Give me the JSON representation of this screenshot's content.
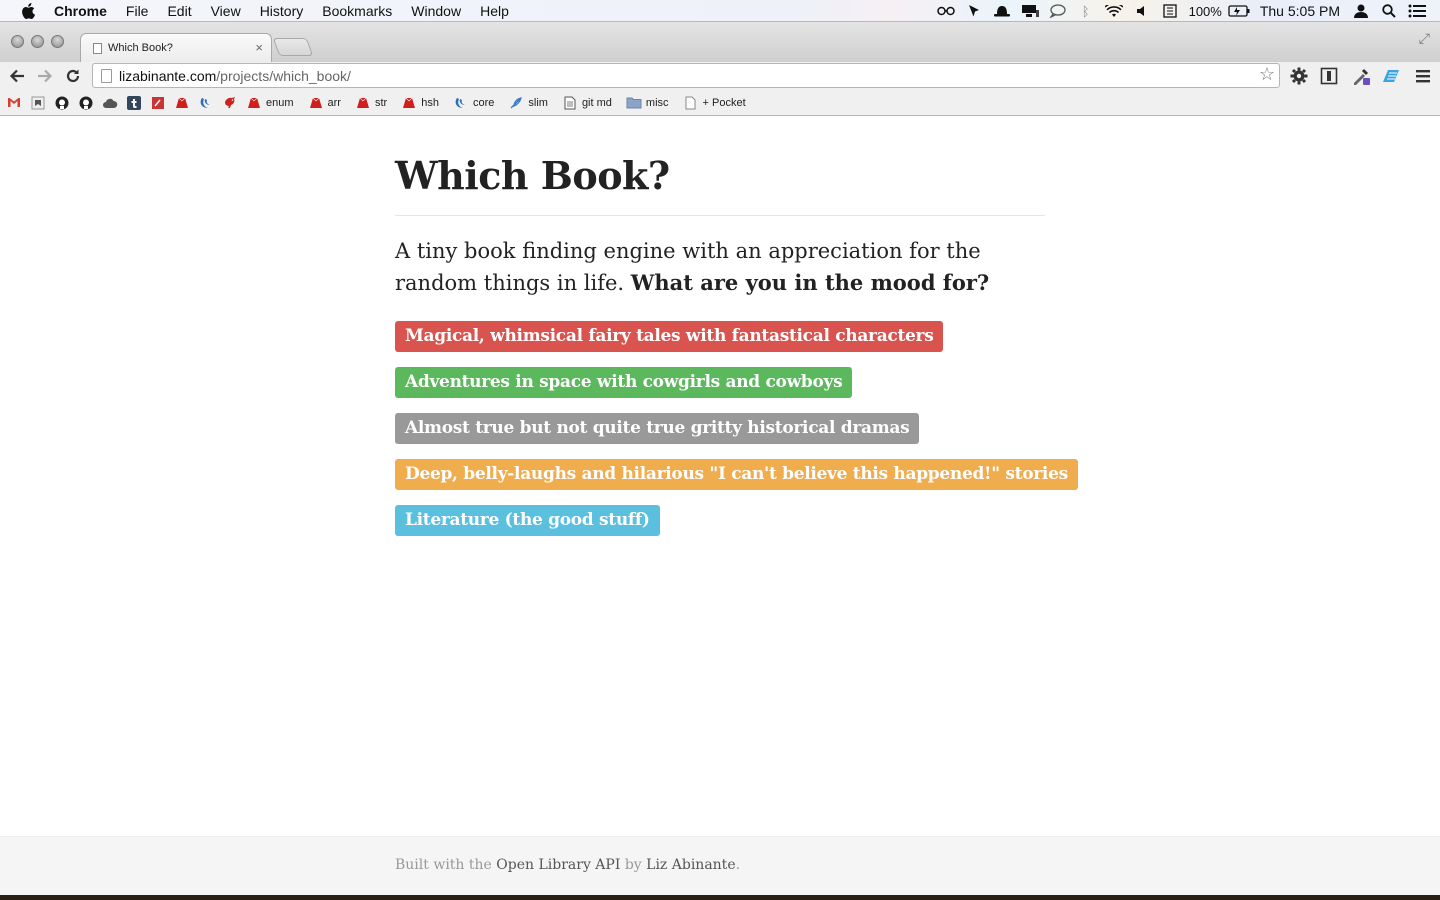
{
  "menubar": {
    "app": "Chrome",
    "items": [
      "File",
      "Edit",
      "View",
      "History",
      "Bookmarks",
      "Window",
      "Help"
    ],
    "battery": "100%",
    "clock": "Thu 5:05 PM"
  },
  "browser": {
    "tab_title": "Which Book?",
    "url_domain": "lizabinante.com",
    "url_path": "/projects/which_book/"
  },
  "bookmarks": [
    {
      "icon": "gmail-icon",
      "label": ""
    },
    {
      "icon": "bookmark-icon",
      "label": ""
    },
    {
      "icon": "github-icon",
      "label": ""
    },
    {
      "icon": "github-icon",
      "label": ""
    },
    {
      "icon": "cloud-icon",
      "label": ""
    },
    {
      "icon": "tumblr-icon",
      "label": ""
    },
    {
      "icon": "square-icon",
      "label": ""
    },
    {
      "icon": "ruby-icon",
      "label": ""
    },
    {
      "icon": "jquery-icon",
      "label": ""
    },
    {
      "icon": "bird-icon",
      "label": ""
    },
    {
      "icon": "ruby-icon",
      "label": "enum"
    },
    {
      "icon": "ruby-icon",
      "label": "arr"
    },
    {
      "icon": "ruby-icon",
      "label": "str"
    },
    {
      "icon": "ruby-icon",
      "label": "hsh"
    },
    {
      "icon": "jquery-icon",
      "label": "core"
    },
    {
      "icon": "feather-icon",
      "label": "slim"
    },
    {
      "icon": "document-icon",
      "label": "git md"
    },
    {
      "icon": "folder-icon",
      "label": "misc"
    },
    {
      "icon": "page-icon",
      "label": "+ Pocket"
    }
  ],
  "page": {
    "title": "Which Book?",
    "lead": "A tiny book finding engine with an appreciation for the random things in life.",
    "lead_bold": "What are you in the mood for?",
    "moods": [
      {
        "label": "Magical, whimsical fairy tales with fantastical characters",
        "color": "#d9534f"
      },
      {
        "label": "Adventures in space with cowgirls and cowboys",
        "color": "#5cb85c"
      },
      {
        "label": "Almost true but not quite true gritty historical dramas",
        "color": "#999999"
      },
      {
        "label": "Deep, belly-laughs and hilarious \"I can't believe this happened!\" stories",
        "color": "#f0ad4e"
      },
      {
        "label": "Literature (the good stuff)",
        "color": "#5bc0de"
      }
    ]
  },
  "footer": {
    "prefix": "Built with the",
    "api_link": "Open Library API",
    "by": "by",
    "author_link": "Liz Abinante",
    "suffix": "."
  }
}
